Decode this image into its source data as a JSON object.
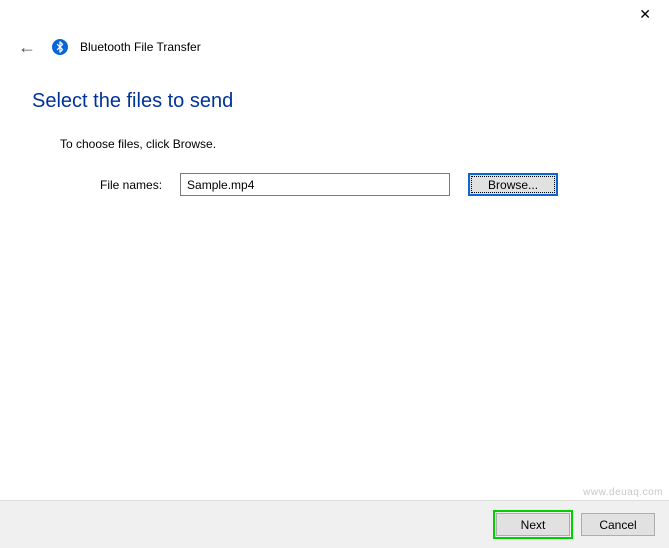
{
  "titlebar": {
    "close_glyph": "✕"
  },
  "header": {
    "back_glyph": "←",
    "app_title": "Bluetooth File Transfer"
  },
  "main": {
    "heading": "Select the files to send",
    "instruction": "To choose files, click Browse.",
    "file_label": "File names:",
    "file_value": "Sample.mp4",
    "browse_label": "Browse..."
  },
  "footer": {
    "next_label": "Next",
    "cancel_label": "Cancel"
  },
  "watermark": "www.deuaq.com"
}
